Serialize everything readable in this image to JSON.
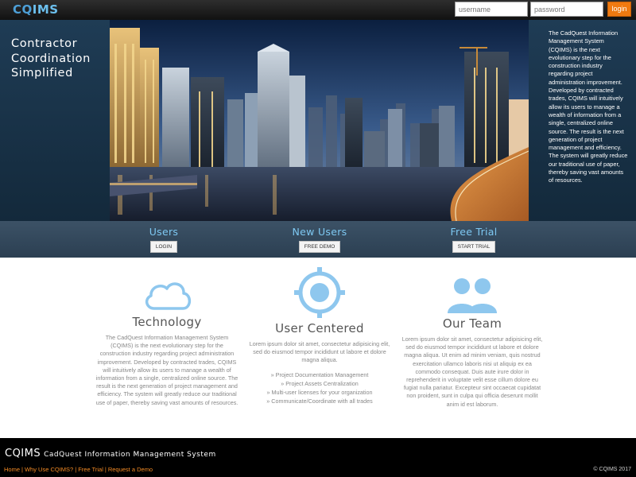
{
  "header": {
    "logo_part1": "CQ",
    "logo_part2": "IMS",
    "username_placeholder": "username",
    "password_placeholder": "password",
    "login_label": "login"
  },
  "hero": {
    "tagline": [
      "Contractor",
      "Coordination",
      "Simplified"
    ],
    "description": "The CadQuest Information Management System (CQIMS) is the next evolutionary step for the construction industry regarding project administration improvement. Developed by contracted trades, CQIMS will intuitively allow its users to manage a wealth of information from a single, centralized online source. The result is the next generation of project management and efficiency. The system will greatly reduce our traditional use of paper, thereby saving vast amounts of resources."
  },
  "actions": [
    {
      "title": "Users",
      "button": "LOGIN"
    },
    {
      "title": "New Users",
      "button": "FREE DEMO"
    },
    {
      "title": "Free Trial",
      "button": "START TRIAL"
    }
  ],
  "features": {
    "technology": {
      "title": "Technology",
      "body": "The CadQuest Information Management System (CQIMS) is the next evolutionary step for the construction industry regarding project administration improvement. Developed by contracted trades, CQIMS will intuitively allow its users to manage a wealth of information from a single, centralized online source. The result is the next generation of project management and efficiency. The system will greatly reduce our traditional use of paper, thereby saving vast amounts of resources.",
      "icon": "cloud-icon"
    },
    "user_centered": {
      "title": "User Centered",
      "body": "Lorem ipsum dolor sit amet, consectetur adipisicing elit, sed do eiusmod tempor incididunt ut labore et dolore magna aliqua.",
      "list": [
        "Project Documentation Management",
        "Project Assets Centralization",
        "Multi-user licenses for your organization",
        "Communicate/Coordinate with all trades"
      ],
      "icon": "crosshair-icon"
    },
    "our_team": {
      "title": "Our Team",
      "body": "Lorem ipsum dolor sit amet, consectetur adipisicing elit, sed do eiusmod tempor incididunt ut labore et dolore magna aliqua. Ut enim ad minim veniam, quis nostrud exercitation ullamco laboris nisi ut aliquip ex ea commodo consequat. Duis aute irure dolor in reprehenderit in voluptate velit esse cillum dolore eu fugiat nulla pariatur. Excepteur sint occaecat cupidatat non proident, sunt in culpa qui officia deserunt mollit anim id est laborum.",
      "icon": "users-icon"
    }
  },
  "footer": {
    "brand": "CQIMS",
    "brand_full": "CadQuest Information Management System",
    "links": [
      "Home",
      "Why Use CQIMS?",
      "Free Trial",
      "Request a Demo"
    ],
    "copyright": "© CQIMS 2017"
  },
  "colors": {
    "accent": "#f07a10",
    "link_blue": "#7ec8f2",
    "icon_blue": "#8ec7ee"
  }
}
